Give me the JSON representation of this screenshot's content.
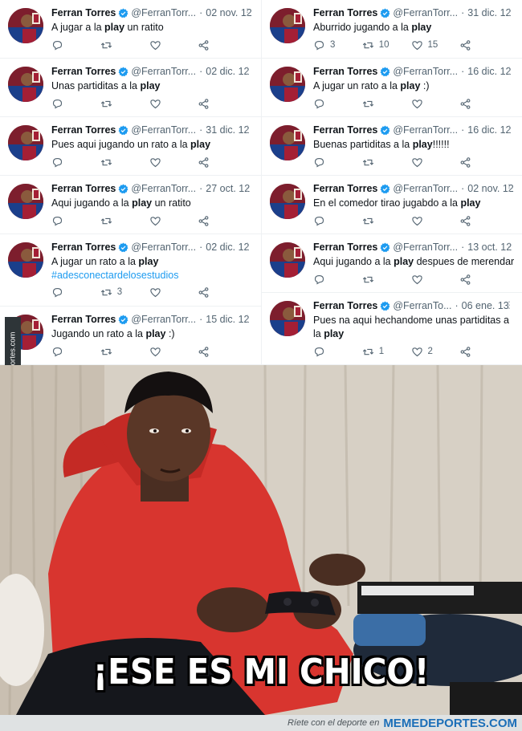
{
  "author": {
    "name": "Ferran Torres",
    "handle_short": "@FerranTorr...",
    "handle_shorter": "@FerranTo...",
    "separator": "·"
  },
  "left_tweets": [
    {
      "date": "02 nov. 12",
      "pre": "A jugar a la ",
      "bold": "play",
      "post": " un ratito",
      "hashtag": "",
      "reply": "",
      "retweet": "",
      "like": ""
    },
    {
      "date": "02 dic. 12",
      "pre": "Unas partiditas a la ",
      "bold": "play",
      "post": "",
      "hashtag": "",
      "reply": "",
      "retweet": "",
      "like": ""
    },
    {
      "date": "31 dic. 12",
      "pre": "Pues aqui jugando un rato a la ",
      "bold": "play",
      "post": "",
      "hashtag": "",
      "reply": "",
      "retweet": "",
      "like": ""
    },
    {
      "date": "27 oct. 12",
      "pre": "Aqui jugando a la ",
      "bold": "play",
      "post": " un ratito",
      "hashtag": "",
      "reply": "",
      "retweet": "",
      "like": ""
    },
    {
      "date": "02 dic. 12",
      "pre": "A jugar un rato a la ",
      "bold": "play",
      "post": "",
      "hashtag": "#adesconectardelosestudios",
      "reply": "",
      "retweet": "3",
      "like": ""
    },
    {
      "date": "15 dic. 12",
      "pre": "Jugando un rato a la ",
      "bold": "play",
      "post": " :)",
      "hashtag": "",
      "reply": "",
      "retweet": "",
      "like": ""
    }
  ],
  "right_tweets": [
    {
      "date": "31 dic. 12",
      "pre": "Aburrido jugando a la ",
      "bold": "play",
      "post": "",
      "reply": "3",
      "retweet": "10",
      "like": "15"
    },
    {
      "date": "16 dic. 12",
      "pre": "A jugar un rato a la ",
      "bold": "play",
      "post": " :)",
      "reply": "",
      "retweet": "",
      "like": ""
    },
    {
      "date": "16 dic. 12",
      "pre": "Buenas partiditas a la ",
      "bold": "play",
      "post": "!!!!!!",
      "reply": "",
      "retweet": "",
      "like": ""
    },
    {
      "date": "02 nov. 12",
      "pre": "En el comedor tirao jugabdo a la ",
      "bold": "play",
      "post": "",
      "reply": "",
      "retweet": "",
      "like": ""
    },
    {
      "date": "13 oct. 12",
      "pre": "Aqui jugando a la ",
      "bold": "play",
      "post": " despues de merendar",
      "reply": "",
      "retweet": "",
      "like": ""
    },
    {
      "date": "06 ene. 13",
      "pre": "Pues na aqui hechandome unas partiditas a la ",
      "bold": "play",
      "post": "",
      "reply": "",
      "retweet": "1",
      "like": "2"
    }
  ],
  "side_watermark": "Memedeportes.com",
  "caption": "¡ESE ES MI CHICO!",
  "footer": {
    "tagline": "Ríete con el deporte en",
    "brand": "MEMEDEPORTES.COM"
  },
  "colors": {
    "verified": "#1d9bf0",
    "hashtag": "#1d9bf0",
    "hoodie": "#d8352f",
    "brand": "#1c6fb8"
  }
}
